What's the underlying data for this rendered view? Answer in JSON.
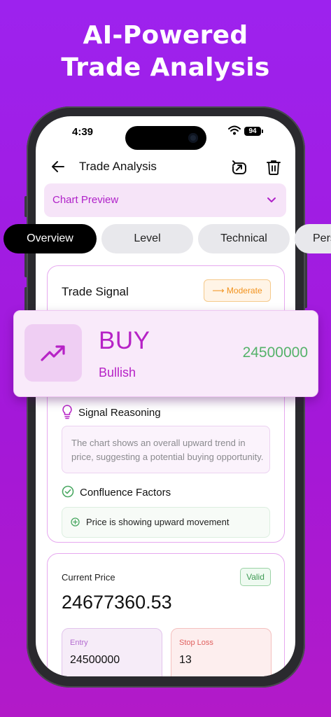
{
  "headline": {
    "line1": "AI-Powered",
    "line2": "Trade Analysis"
  },
  "status_bar": {
    "time": "4:39",
    "battery": "94"
  },
  "nav": {
    "title": "Trade Analysis"
  },
  "chart_preview": {
    "label": "Chart Preview"
  },
  "tabs": [
    {
      "label": "Overview",
      "active": true
    },
    {
      "label": "Level",
      "active": false
    },
    {
      "label": "Technical",
      "active": false
    },
    {
      "label": "Pers",
      "active": false
    }
  ],
  "trade_signal": {
    "title": "Trade Signal",
    "strength": "Moderate",
    "action": "BUY",
    "sentiment": "Bullish",
    "price": "24500000"
  },
  "signal_reasoning": {
    "title": "Signal Reasoning",
    "text": "The chart shows an overall upward trend in price, suggesting a potential buying opportunity."
  },
  "confluence": {
    "title": "Confluence Factors",
    "items": [
      "Price is showing upward movement"
    ]
  },
  "price_card": {
    "label": "Current Price",
    "status": "Valid",
    "value": "24677360.53",
    "entry_label": "Entry",
    "entry_value": "24500000",
    "stop_loss_label": "Stop Loss",
    "stop_loss_value": "13"
  },
  "colors": {
    "accent": "#b622c6",
    "background": "#9d22ee",
    "positive": "#55b26a",
    "warning": "#f2921c",
    "negative": "#e0605e"
  }
}
